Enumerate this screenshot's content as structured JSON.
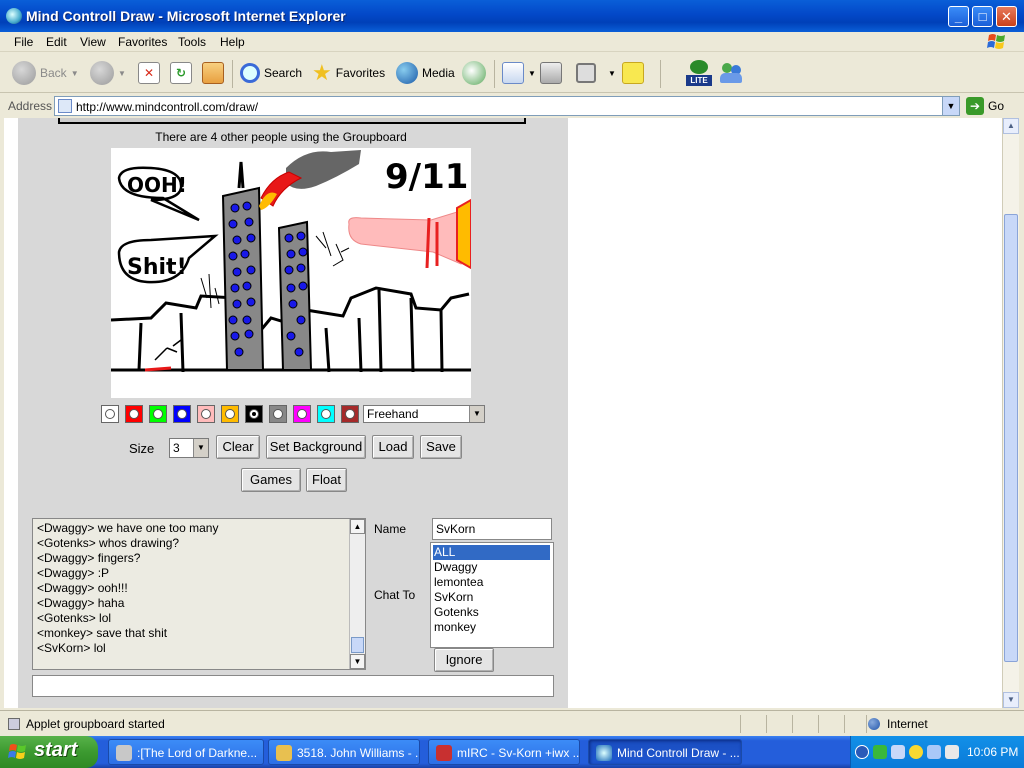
{
  "window": {
    "title": "Mind Controll Draw - Microsoft Internet Explorer",
    "buttons": [
      "_",
      "□",
      "✕"
    ]
  },
  "menu": [
    "File",
    "Edit",
    "View",
    "Favorites",
    "Tools",
    "Help"
  ],
  "toolbar": {
    "back": "Back",
    "search": "Search",
    "favorites": "Favorites",
    "media": "Media",
    "lite": "LITE"
  },
  "address": {
    "label": "Address",
    "url": "http://www.mindcontroll.com/draw/",
    "go": "Go"
  },
  "groupboard": {
    "users_info": "There are 4 other people using the Groupboard",
    "canvas_text": {
      "date": "9/11",
      "bubble1": "OOH!",
      "bubble2": "Shit!"
    },
    "palette": [
      {
        "color": "#ffffff",
        "selected": false
      },
      {
        "color": "#ff0000",
        "selected": false
      },
      {
        "color": "#00ff00",
        "selected": false
      },
      {
        "color": "#0000ff",
        "selected": false
      },
      {
        "color": "#ffbbbb",
        "selected": false
      },
      {
        "color": "#ffbb00",
        "selected": false
      },
      {
        "color": "#000000",
        "selected": true
      },
      {
        "color": "#888888",
        "selected": false
      },
      {
        "color": "#ff00ff",
        "selected": false
      },
      {
        "color": "#00ffff",
        "selected": false
      },
      {
        "color": "#a52a2a",
        "selected": false
      }
    ],
    "tool_select": "Freehand",
    "size_label": "Size",
    "size_value": "3",
    "buttons": {
      "clear": "Clear",
      "set_background": "Set Background",
      "load": "Load",
      "save": "Save",
      "games": "Games",
      "float": "Float",
      "ignore": "Ignore"
    },
    "chat_lines": [
      "<Dwaggy> we have one too many",
      "<Gotenks> whos drawing?",
      "<Dwaggy> fingers?",
      "<Dwaggy> :P",
      "<Dwaggy> ooh!!!",
      "<Dwaggy> haha",
      "<Gotenks> lol",
      "<monkey> save that shit",
      "<SvKorn> lol"
    ],
    "name_label": "Name",
    "name_value": "SvKorn",
    "chat_to_label": "Chat To",
    "users": [
      "ALL",
      "Dwaggy",
      "lemontea",
      "SvKorn",
      "Gotenks",
      "monkey"
    ]
  },
  "status": {
    "text": "Applet groupboard started",
    "zone": "Internet"
  },
  "taskbar": {
    "start": "start",
    "tasks": [
      ":[The Lord of Darkne...",
      "3518. John Williams - ...",
      "mIRC - Sv-Korn +iwx ...",
      "Mind Controll Draw - ..."
    ],
    "clock": "10:06 PM"
  }
}
